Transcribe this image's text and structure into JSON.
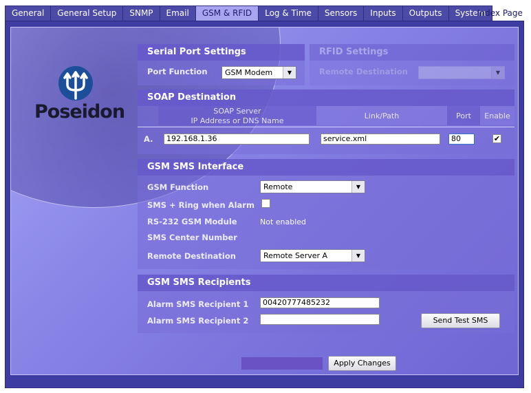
{
  "tabs": [
    "General",
    "General Setup",
    "SNMP",
    "Email",
    "GSM & RFID",
    "Log & Time",
    "Sensors",
    "Inputs",
    "Outputs",
    "System"
  ],
  "index_link": "Index Page",
  "logo_text": "Poseidon",
  "serial": {
    "title": "Serial Port Settings",
    "port_function_label": "Port Function",
    "port_function_value": "GSM Modem"
  },
  "rfid": {
    "title": "RFID Settings",
    "remote_destination_label": "Remote Destination"
  },
  "soap": {
    "title": "SOAP Destination",
    "col_server_line1": "SOAP Server",
    "col_server_line2": "IP Address or DNS Name",
    "col_path": "Link/Path",
    "col_port": "Port",
    "col_enable": "Enable",
    "row_label": "A.",
    "server": "192.168.1.36",
    "path": "service.xml",
    "port": "80",
    "enable_mark": "✔"
  },
  "sms_interface": {
    "title": "GSM SMS Interface",
    "gsm_function_label": "GSM Function",
    "gsm_function_value": "Remote",
    "sms_ring_label": "SMS + Ring when Alarm",
    "rs232_label": "RS-232 GSM Module",
    "rs232_value": "Not enabled",
    "center_label": "SMS Center Number",
    "remote_dest_label": "Remote Destination",
    "remote_dest_value": "Remote Server A"
  },
  "sms_recipients": {
    "title": "GSM SMS Recipients",
    "r1_label": "Alarm SMS Recipient 1",
    "r1_value": "00420777485232",
    "r2_label": "Alarm SMS Recipient 2",
    "r2_value": "",
    "test_button": "Send Test SMS"
  },
  "apply_button": "Apply Changes"
}
